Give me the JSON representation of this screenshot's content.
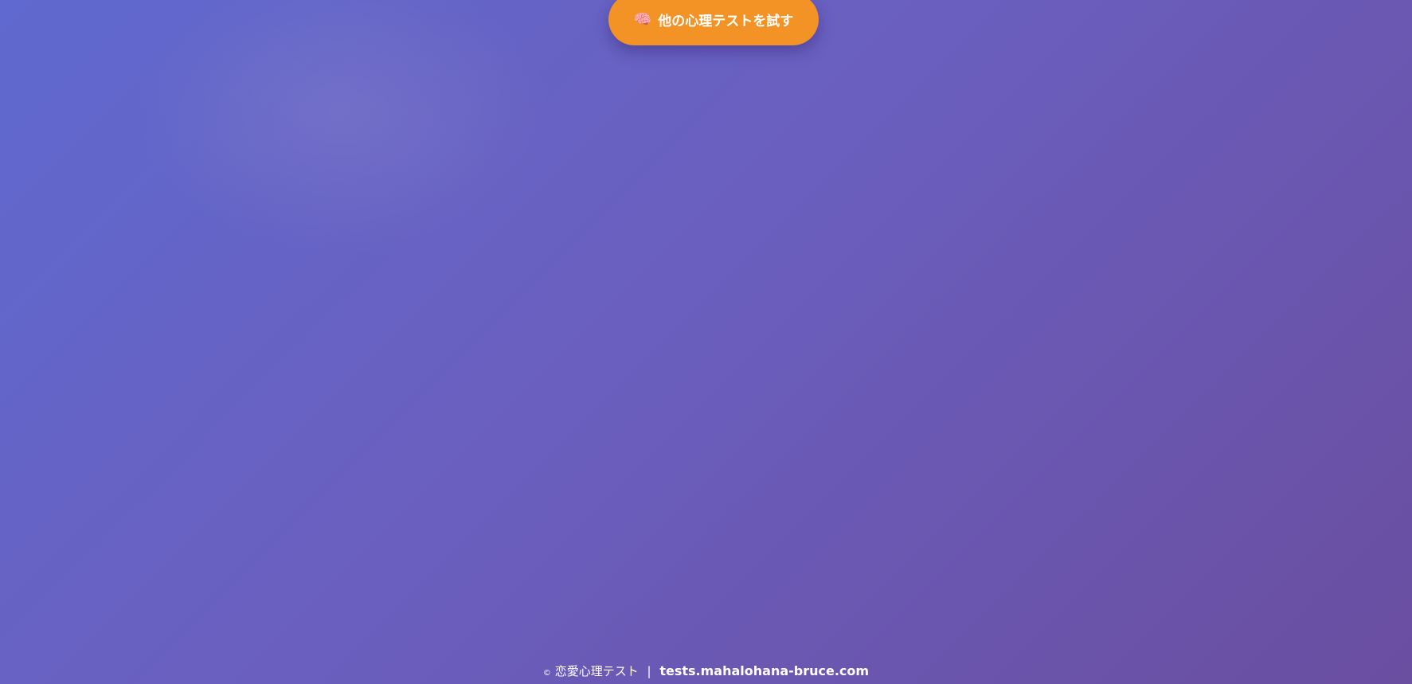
{
  "cta": {
    "icon": "🧠",
    "label": "他の心理テストを試す"
  },
  "footer": {
    "copyright_symbol": "©",
    "site_name": "恋愛心理テスト",
    "separator": "|",
    "domain": "tests.mahalohana-bruce.com"
  },
  "colors": {
    "accent": "#f39225",
    "background_start": "#5f69cf",
    "background_end": "#6a4ea0"
  }
}
